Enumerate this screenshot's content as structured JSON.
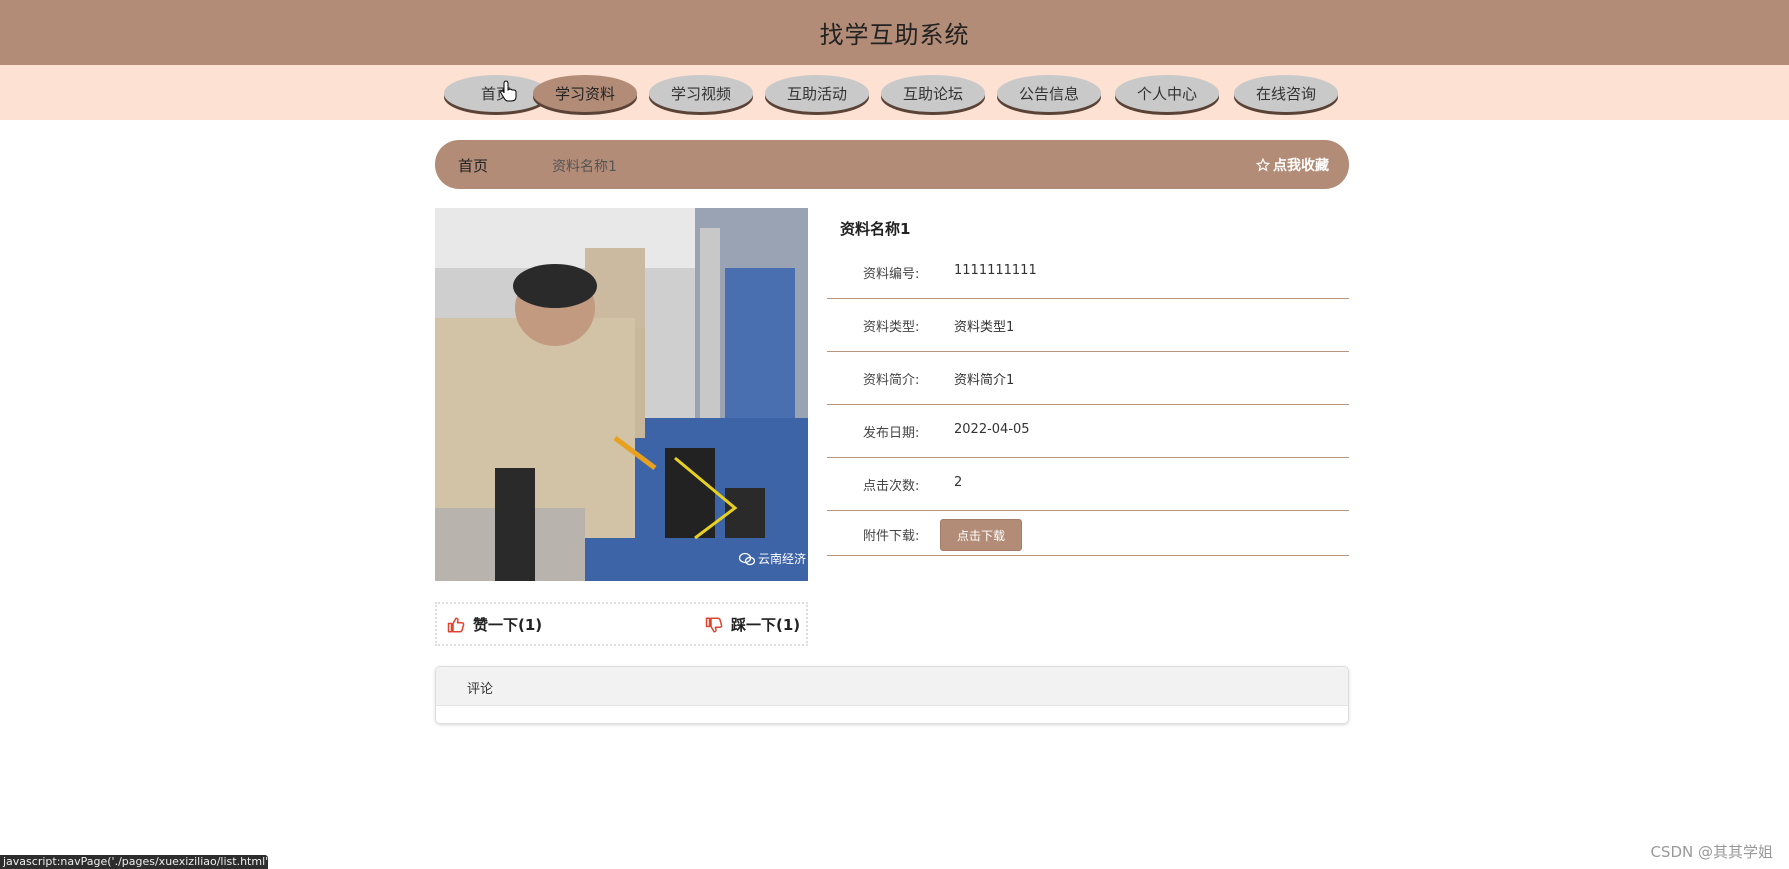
{
  "header": {
    "title": "找学互助系统"
  },
  "nav": {
    "items": [
      {
        "label": "首页"
      },
      {
        "label": "学习资料"
      },
      {
        "label": "学习视频"
      },
      {
        "label": "互助活动"
      },
      {
        "label": "互助论坛"
      },
      {
        "label": "公告信息"
      },
      {
        "label": "个人中心"
      },
      {
        "label": "在线咨询"
      }
    ],
    "active_index": 1
  },
  "breadcrumb": {
    "home": "首页",
    "current": "资料名称1",
    "favorite": "点我收藏"
  },
  "detail": {
    "title": "资料名称1",
    "fields": [
      {
        "label": "资料编号:",
        "value": "1111111111"
      },
      {
        "label": "资料类型:",
        "value": "资料类型1"
      },
      {
        "label": "资料简介:",
        "value": "资料简介1"
      },
      {
        "label": "发布日期:",
        "value": "2022-04-05"
      },
      {
        "label": "点击次数:",
        "value": "2"
      }
    ],
    "download_label": "附件下载:",
    "download_button": "点击下载"
  },
  "photo": {
    "watermark": "云南经济"
  },
  "votes": {
    "like": "赞一下(1)",
    "dislike": "踩一下(1)"
  },
  "comments": {
    "title": "评论"
  },
  "status_bar": "javascript:navPage('./pages/xuexiziliao/list.html')",
  "credit": "CSDN @其其学姐",
  "colors": {
    "brand": "#b38c77",
    "nav_bg": "#fde1d3",
    "nav_item": "#c9c9c9",
    "icon_red": "#e0442f"
  }
}
